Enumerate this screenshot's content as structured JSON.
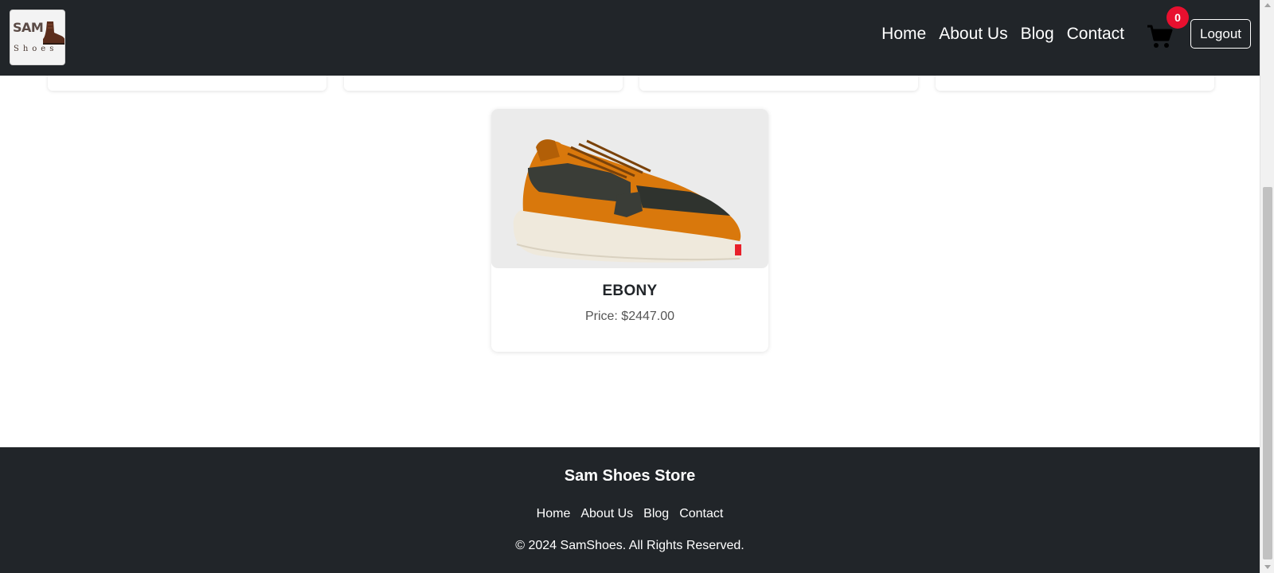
{
  "header": {
    "logo": {
      "line1": "SAM",
      "line2": "Shoes"
    },
    "nav": [
      {
        "label": "Home"
      },
      {
        "label": "About Us"
      },
      {
        "label": "Blog"
      },
      {
        "label": "Contact"
      }
    ],
    "cart": {
      "icon": "cart-icon",
      "count": "0"
    },
    "logout_label": "Logout"
  },
  "product": {
    "name": "EBONY",
    "price": "Price: $2447.00",
    "image_icon": "sneaker-image"
  },
  "footer": {
    "title": "Sam Shoes Store",
    "links": [
      {
        "label": "Home"
      },
      {
        "label": "About Us"
      },
      {
        "label": "Blog"
      },
      {
        "label": "Contact"
      }
    ],
    "copyright": "© 2024 SamShoes. All Rights Reserved."
  },
  "colors": {
    "navbar_bg": "#212529",
    "badge": "#e8102f",
    "footer_bg": "#212529"
  }
}
